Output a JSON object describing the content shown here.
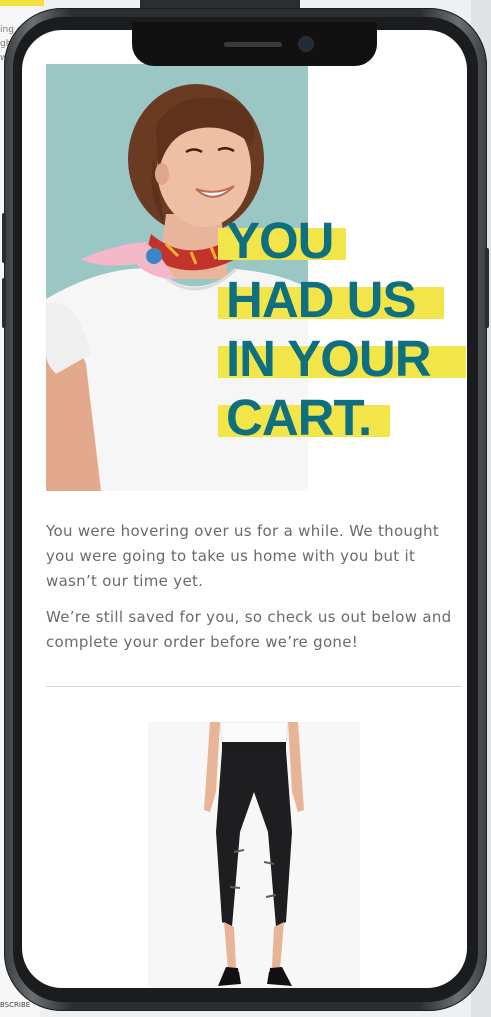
{
  "background": {
    "snippet_lines": [
      "ing o",
      "ght",
      "wi"
    ],
    "subscribe_text": "BSCRIBE"
  },
  "email": {
    "headline_lines": [
      "YOU",
      "HAD US",
      "IN YOUR",
      "CART."
    ],
    "paragraph_1": "You were hovering over us for a while. We thought you were going to take us home with you but it wasn’t our time yet.",
    "paragraph_2": "We’re still saved for you, so check us out below and complete your order before we’re gone!"
  },
  "colors": {
    "headline_text": "#0e6f80",
    "headline_highlight": "#f2e54a",
    "hero_background": "#9ac7c4",
    "body_text": "#6a6a6a"
  },
  "icons": {
    "hero_image": "woman-in-white-tshirt-with-scarf",
    "product_image": "black-ripped-skinny-jeans"
  }
}
